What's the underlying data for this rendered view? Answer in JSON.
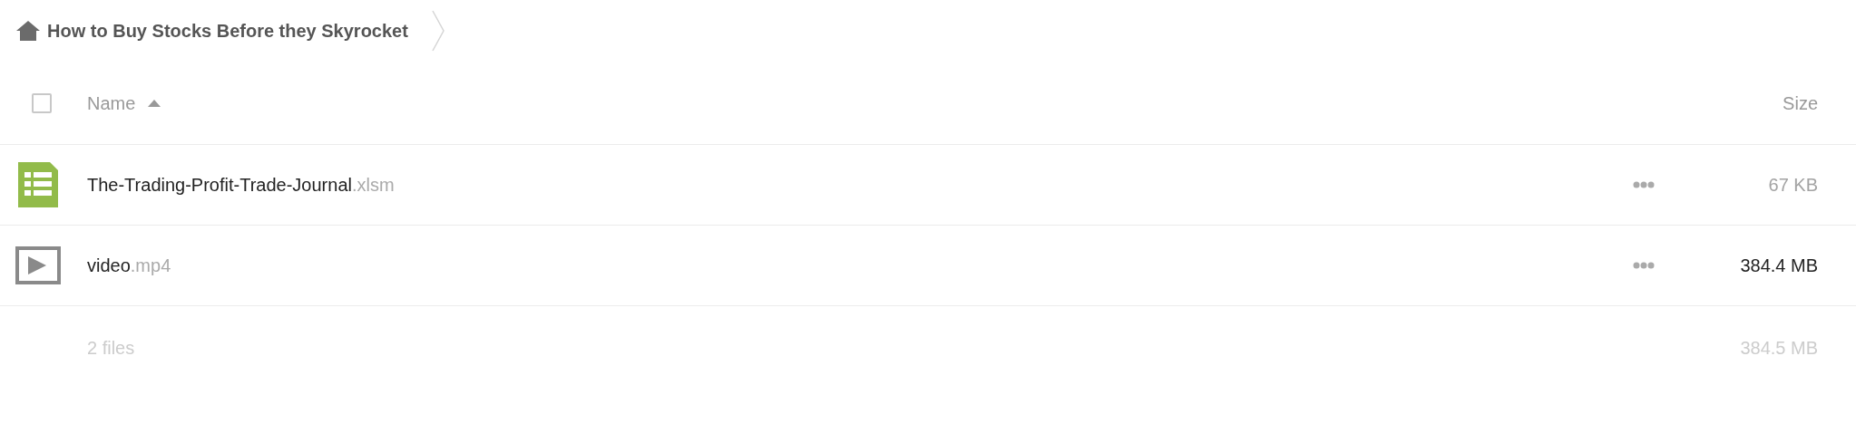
{
  "breadcrumb": {
    "title": "How to Buy Stocks Before they Skyrocket"
  },
  "table": {
    "select_all": {
      "checked": false
    },
    "columns": [
      {
        "label": "Name",
        "sort_ascending": true
      },
      {
        "label": "Size"
      }
    ],
    "rows": [
      {
        "kind": "spreadsheet",
        "name": "The-Trading-Profit-Trade-Journal",
        "extension": ".xlsm",
        "size": "67 KB",
        "color": "#a3a3a3"
      },
      {
        "kind": "video",
        "name": "video",
        "extension": ".mp4",
        "size": "384.4 MB",
        "color": "#222222"
      }
    ],
    "footer": {
      "count": "2 files",
      "total": "384.5 MB"
    }
  }
}
